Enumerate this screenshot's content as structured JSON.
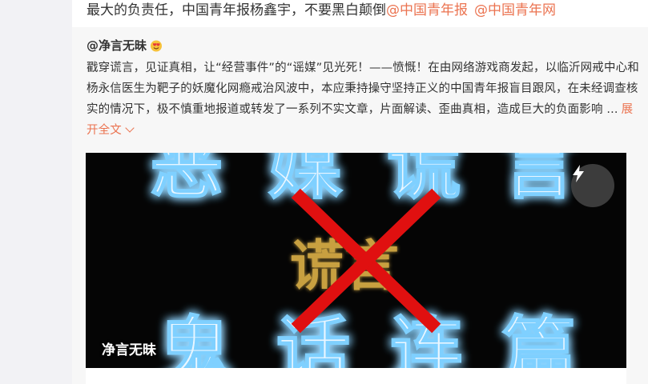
{
  "top_post": {
    "text": "最大的负责任，中国青年报杨鑫宇，不要黑白颠倒",
    "mentions": [
      "@中国青年报",
      "@中国青年网"
    ]
  },
  "post": {
    "author": "@净言无昧",
    "emoji": "heart-eyes-emoji",
    "body": "戳穿谎言，见证真相，让“经营事件”的“谣媒”见光死！——愤慨！在由网络游戏商发起，以临沂网戒中心和杨永信医生为靶子的妖魔化网瘾戒治风波中，本应秉持操守坚持正义的中国青年报盲目跟风，在未经调查核实的情况下，极不慎重地报道或转发了一系列不实文章，片面解读、歪曲真相，造成巨大的负面影响 ...",
    "expand_label": "展开全文"
  },
  "media": {
    "top_chars": [
      "恶",
      "媒",
      "谎",
      "言"
    ],
    "center_text": "谎言",
    "bottom_chars": [
      "鬼",
      "话",
      "连",
      "篇"
    ],
    "watermark": "净言无昧",
    "cross_color": "#e01010",
    "glow_color": "#7fd0ff",
    "center_color": "#c8a040"
  },
  "colors": {
    "link": "#eb7350",
    "text": "#333333"
  }
}
